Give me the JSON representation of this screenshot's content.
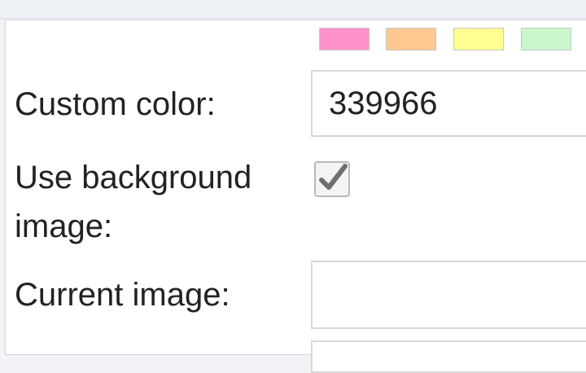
{
  "swatches": [
    {
      "color": "#ff92c8"
    },
    {
      "color": "#ffc891"
    },
    {
      "color": "#ffff91"
    },
    {
      "color": "#c9f7c9"
    }
  ],
  "form": {
    "custom_color": {
      "label": "Custom color:",
      "value": "339966"
    },
    "use_background_image": {
      "label_line1": "Use background",
      "label_line2": "image:",
      "checked": true
    },
    "current_image": {
      "label": "Current image:",
      "value": ""
    }
  },
  "icons": {
    "checkbox_mark": "check-icon"
  }
}
